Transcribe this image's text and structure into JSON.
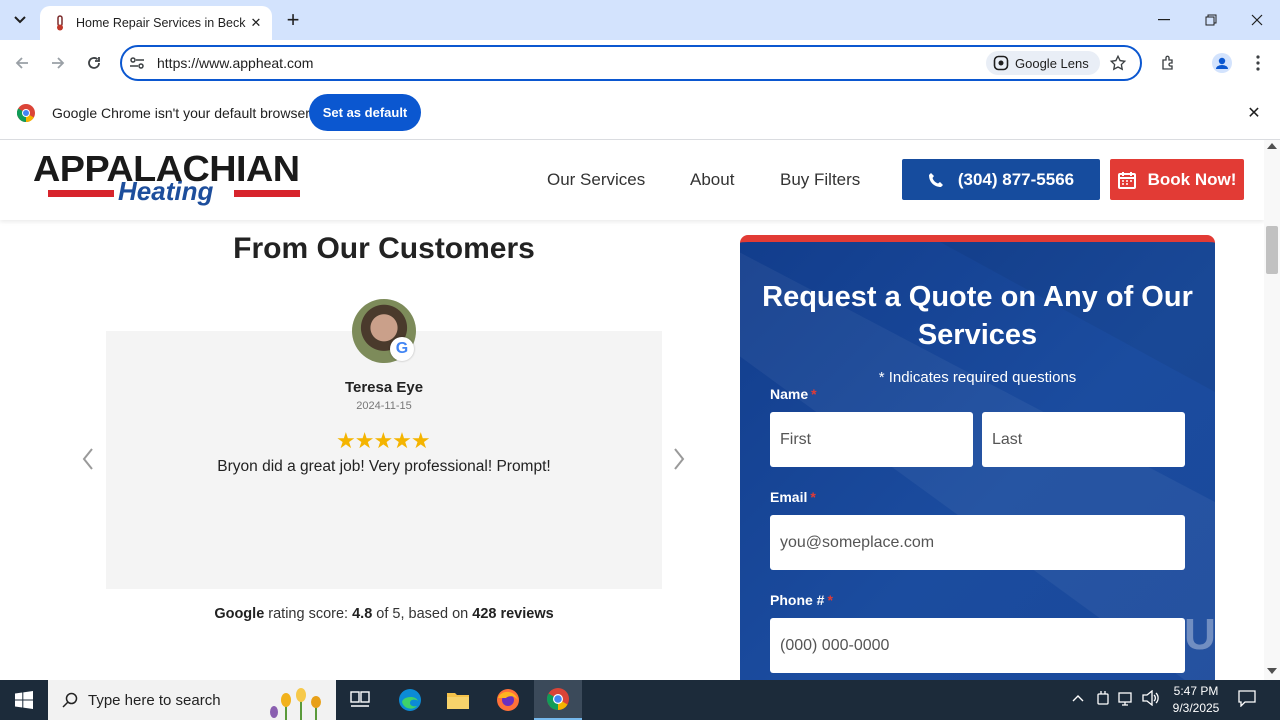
{
  "browser": {
    "tab_title": "Home Repair Services in Beckle",
    "new_tab_symbol": "+",
    "url": "https://www.appheat.com",
    "lens_label": "Google Lens",
    "infobar_text": "Google Chrome isn't your default browser",
    "set_default_label": "Set as default"
  },
  "site": {
    "logo_top": "APPALACHIAN",
    "logo_bottom": "Heating",
    "nav": [
      "Our Services",
      "About",
      "Buy Filters"
    ],
    "phone": "(304) 877-5566",
    "book": "Book Now!"
  },
  "reviews": {
    "section_title": "From Our Customers",
    "name": "Teresa Eye",
    "date": "2024-11-15",
    "stars": "★★★★★",
    "text": "Bryon did a great job! Very professional! Prompt!",
    "rating_google": "Google",
    "rating_prefix": " rating score: ",
    "rating_score": "4.8",
    "rating_of": " of 5, based on ",
    "rating_count": "428 reviews"
  },
  "quote_form": {
    "title": "Request a Quote on Any of Our Services",
    "subtitle": "* Indicates required questions",
    "name_label": "Name",
    "first_placeholder": "First",
    "last_placeholder": "Last",
    "email_label": "Email",
    "email_placeholder": "you@someplace.com",
    "phone_label": "Phone #",
    "phone_placeholder": "(000) 000-0000",
    "required_mark": "*"
  },
  "taskbar": {
    "search_placeholder": "Type here to search",
    "time": "5:47 PM",
    "date": "9/3/2025"
  },
  "watermark": "ANY RUN",
  "colors": {
    "brand_blue": "#164c9e",
    "brand_red": "#e23b35",
    "chrome_blue": "#0b57d0"
  }
}
